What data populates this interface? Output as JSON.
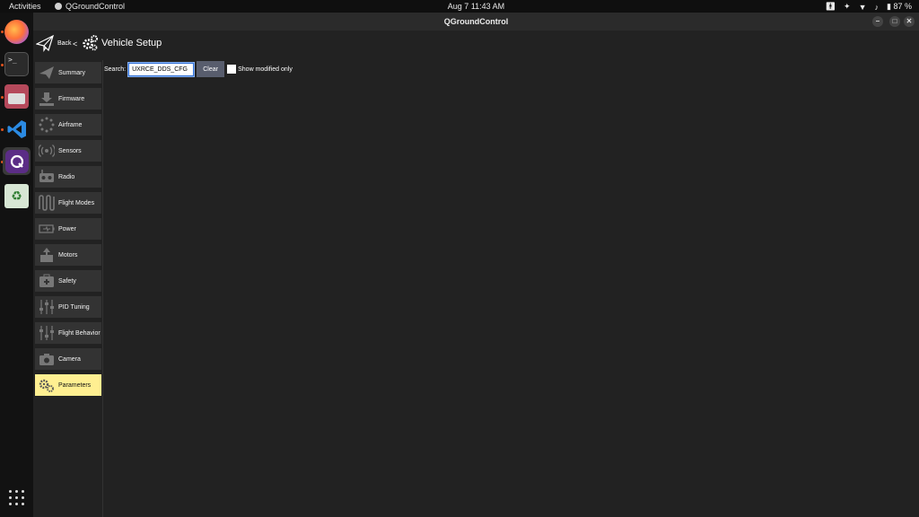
{
  "topbar": {
    "activities": "Activities",
    "app_name": "QGroundControl",
    "clock": "Aug 7  11:43 AM",
    "battery": "87 %"
  },
  "dock": {
    "items": [
      "firefox-icon",
      "terminal-icon",
      "files-icon",
      "vscode-icon",
      "qgroundcontrol-icon",
      "trash-icon"
    ],
    "terminal_glyph": ">_"
  },
  "window": {
    "title": "QGroundControl"
  },
  "header": {
    "back_label": "Back",
    "separator": "<",
    "title": "Vehicle Setup"
  },
  "sidebar": {
    "items": [
      {
        "label": "Summary",
        "icon": "plane-icon"
      },
      {
        "label": "Firmware",
        "icon": "download-icon"
      },
      {
        "label": "Airframe",
        "icon": "airframe-icon"
      },
      {
        "label": "Sensors",
        "icon": "sensors-icon"
      },
      {
        "label": "Radio",
        "icon": "radio-icon"
      },
      {
        "label": "Flight Modes",
        "icon": "flight-modes-icon"
      },
      {
        "label": "Power",
        "icon": "battery-icon"
      },
      {
        "label": "Motors",
        "icon": "motor-icon"
      },
      {
        "label": "Safety",
        "icon": "first-aid-icon"
      },
      {
        "label": "PID Tuning",
        "icon": "sliders-icon"
      },
      {
        "label": "Flight Behavior",
        "icon": "sliders-icon"
      },
      {
        "label": "Camera",
        "icon": "camera-icon"
      },
      {
        "label": "Parameters",
        "icon": "gears-icon"
      }
    ],
    "selected": "Parameters"
  },
  "search": {
    "label": "Search:",
    "value": "UXRCE_DDS_CFG",
    "clear_label": "Clear",
    "modified_only_label": "Show modified only",
    "modified_only_checked": false
  },
  "colors": {
    "selected": "#ffef91",
    "button_bg": "#333333",
    "accent": "#2f6fd6"
  }
}
